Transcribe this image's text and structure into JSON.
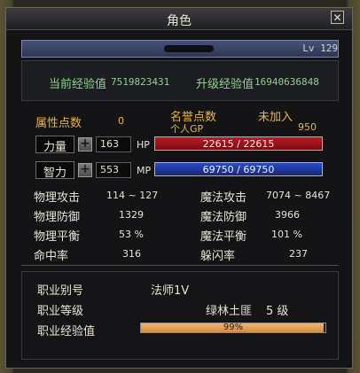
{
  "window": {
    "title": "角色",
    "close_glyph": "✕"
  },
  "header": {
    "level": "Lv 129"
  },
  "exp": {
    "current_label": "当前经验值",
    "current_value": "7519823431",
    "upgrade_label": "升级经验值",
    "upgrade_value": "16940636848"
  },
  "points": {
    "attr_label": "属性点数",
    "attr_value": "0",
    "fame_label": "名誉点数",
    "gp_label": "个人GP",
    "gp_value": "950",
    "guild_status": "未加入"
  },
  "stats": {
    "str_label": "力量",
    "str_value": "163",
    "int_label": "智力",
    "int_value": "553",
    "hp_label": "HP",
    "mp_label": "MP",
    "hp_text": "22615 / 22615",
    "mp_text": "69750 / 69750",
    "hp_fraction": 1.0,
    "mp_fraction": 1.0
  },
  "combat": {
    "rows": [
      {
        "l_label": "物理攻击",
        "l_value": "114 ~ 127",
        "r_label": "魔法攻击",
        "r_value": "7074 ~ 8467"
      },
      {
        "l_label": "物理防御",
        "l_value": "1329",
        "r_label": "魔法防御",
        "r_value": "3966"
      },
      {
        "l_label": "物理平衡",
        "l_value": "53 %",
        "r_label": "魔法平衡",
        "r_value": "101 %"
      },
      {
        "l_label": "命中率",
        "l_value": "316",
        "r_label": "躲闪率",
        "r_value": "237"
      }
    ]
  },
  "job": {
    "alias_label": "职业别号",
    "alias_value": "法师1V",
    "level_label": "职业等级",
    "level_name": "绿林土匪",
    "level_value": "5 级",
    "exp_label": "职业经验值",
    "exp_text": "99%",
    "exp_fraction": 0.99
  },
  "colors": {
    "hp_bar": "#c01a22",
    "mp_bar": "#2a49c6",
    "job_bar": "#d38b43"
  }
}
